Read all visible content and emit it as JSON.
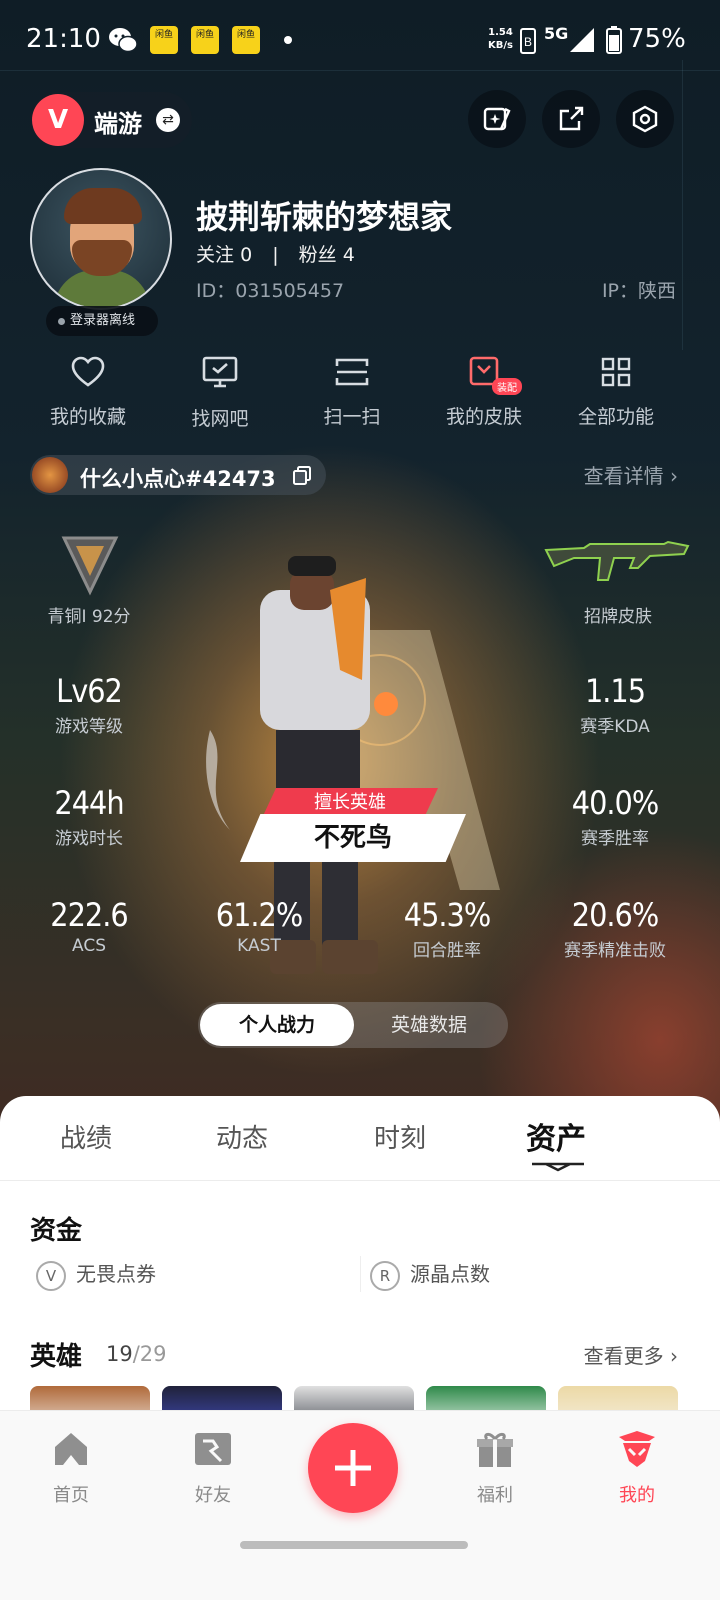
{
  "status_bar": {
    "time": "21:10",
    "net_speed_value": "1.54",
    "net_speed_unit": "KB/s",
    "network": "5G",
    "battery": "75%",
    "mini_app_label": "闲鱼"
  },
  "header": {
    "app_name": "端游",
    "logo_letter": "V"
  },
  "profile": {
    "nickname": "披荆斩棘的梦想家",
    "follow_label": "关注",
    "follow_count": "0",
    "fans_label": "粉丝",
    "fans_count": "4",
    "uid": "ID：031505457",
    "ip": "IP：陕西",
    "login_state": "登录器离线"
  },
  "quick_actions": [
    {
      "label": "我的收藏",
      "icon": "heart-icon"
    },
    {
      "label": "找网吧",
      "icon": "monitor-icon"
    },
    {
      "label": "扫一扫",
      "icon": "scan-icon"
    },
    {
      "label": "我的皮肤",
      "icon": "skin-icon",
      "badge": "装配"
    },
    {
      "label": "全部功能",
      "icon": "grid-icon"
    }
  ],
  "riot_id": {
    "name": "什么小点心#42473",
    "detail_link": "查看详情"
  },
  "card": {
    "rank_label": "青铜I 92分",
    "skin_label": "招牌皮肤",
    "hero_tag": "擅长英雄",
    "hero_name": "不死鸟",
    "stats": {
      "level": {
        "value": "Lv62",
        "label": "游戏等级"
      },
      "kda": {
        "value": "1.15",
        "label": "赛季KDA"
      },
      "playtime": {
        "value": "244h",
        "label": "游戏时长"
      },
      "winrate": {
        "value": "40.0%",
        "label": "赛季胜率"
      },
      "acs": {
        "value": "222.6",
        "label": "ACS"
      },
      "kast": {
        "value": "61.2%",
        "label": "KAST"
      },
      "round_win": {
        "value": "45.3%",
        "label": "回合胜率"
      },
      "precision_kill": {
        "value": "20.6%",
        "label": "赛季精准击败"
      }
    },
    "toggle": [
      "个人战力",
      "英雄数据"
    ]
  },
  "sheet": {
    "tabs": [
      "战绩",
      "动态",
      "时刻",
      "资产"
    ],
    "active_tab": 3,
    "funds_title": "资金",
    "fund_1": "无畏点券",
    "fund_2": "源晶点数",
    "heroes_title": "英雄",
    "heroes_owned": "19",
    "heroes_total": "/29",
    "more_link": "查看更多"
  },
  "bottom_nav": [
    {
      "label": "首页",
      "icon": "home-icon"
    },
    {
      "label": "好友",
      "icon": "friends-icon"
    },
    {
      "label": "福利",
      "icon": "gift-icon"
    },
    {
      "label": "我的",
      "icon": "me-icon"
    }
  ],
  "colors": {
    "accent": "#ff4655",
    "sheet_bg": "#ffffff"
  }
}
